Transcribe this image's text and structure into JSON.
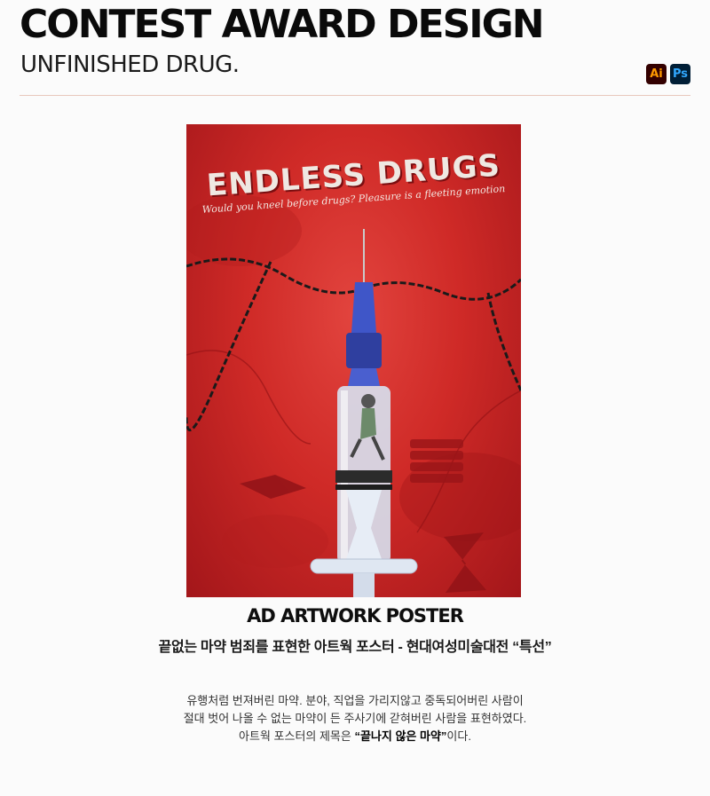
{
  "header": {
    "title": "CONTEST AWARD DESIGN",
    "subtitle": "UNFINISHED DRUG.",
    "tools": [
      {
        "label": "Ai",
        "icon": "illustrator-icon",
        "color": "#ff9a00"
      },
      {
        "label": "Ps",
        "icon": "photoshop-icon",
        "color": "#31a8ff"
      }
    ]
  },
  "poster": {
    "title": "ENDLESS DRUGS",
    "tagline": "Would you kneel before drugs? Pleasure is a fleeting emotion",
    "background_color": "#d4302c"
  },
  "caption": {
    "heading": "AD ARTWORK POSTER",
    "subheading": "끝없는 마약 범죄를 표현한 아트웍 포스터 - 현대여성미술대전 “특선”"
  },
  "description": {
    "line1": "유행처럼 번져버린 마약. 분야, 직업을 가리지않고 중독되어버린 사람이",
    "line2": "절대 벗어 나올 수 없는 마약이 든 주사기에 갇혀버린 사람을 표현하였다.",
    "line3_prefix": "아트웍 포스터의 제목은 ",
    "line3_strong": "“끝나지 않은 마약”",
    "line3_suffix": "이다."
  }
}
